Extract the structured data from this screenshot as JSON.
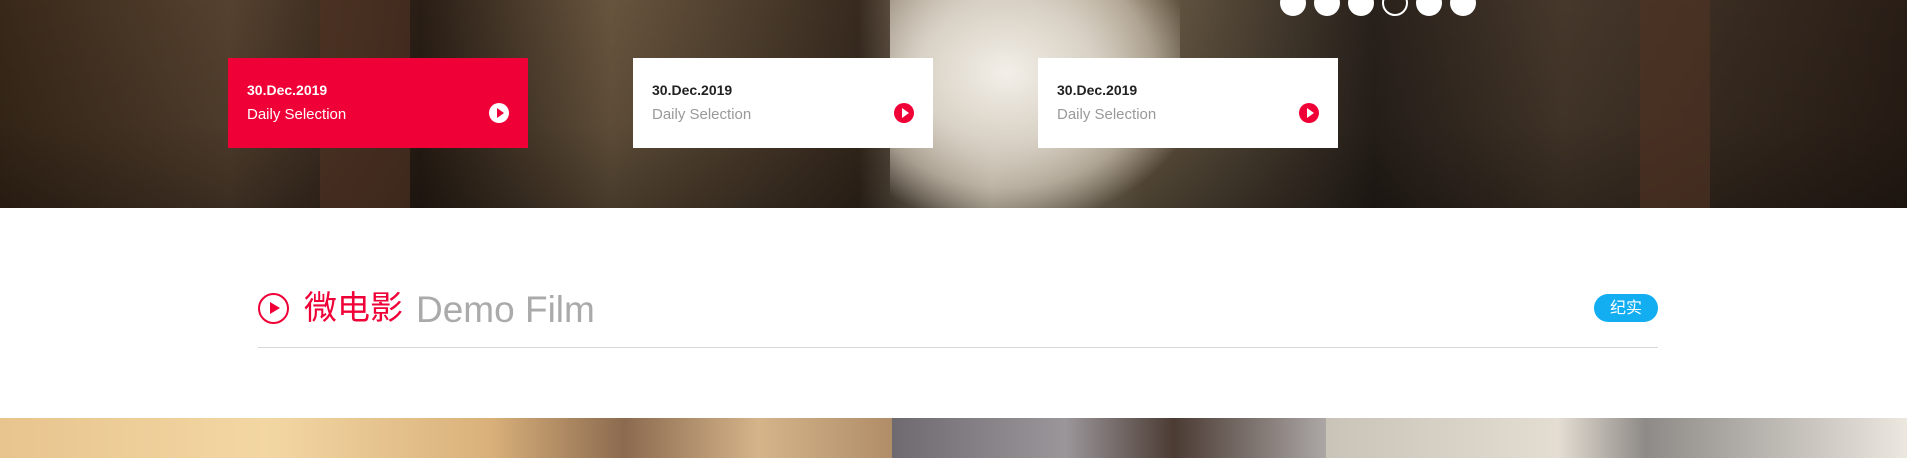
{
  "hero": {
    "slider_dots": 6,
    "active_dot": 3,
    "cards": [
      {
        "date": "30.Dec.2019",
        "label": "Daily Selection",
        "active": true
      },
      {
        "date": "30.Dec.2019",
        "label": "Daily Selection",
        "active": false
      },
      {
        "date": "30.Dec.2019",
        "label": "Daily Selection",
        "active": false
      }
    ]
  },
  "section": {
    "title_cn": "微电影",
    "title_en": "Demo Film",
    "tag": "纪实",
    "icon": "play-circle-icon"
  },
  "colors": {
    "accent": "#ef0037",
    "tag_blue": "#12aef1",
    "muted_text": "#aaaaaa"
  }
}
